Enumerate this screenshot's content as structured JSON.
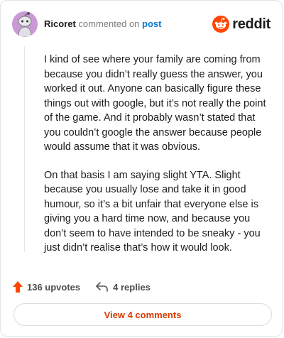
{
  "header": {
    "username": "Ricoret",
    "action_text": "commented on",
    "post_link": "post",
    "brand_name": "reddit"
  },
  "comment": {
    "paragraphs": [
      "I kind of see where your family are coming from because you didn’t really guess the answer, you worked it out. Anyone can basically figure these things out with google, but it’s not really the point of the game. And it probably wasn’t stated that you couldn’t google the answer because people would assume that it was obvious.",
      "On that basis I am saying slight YTA. Slight because you usually lose and take it in good humour, so it’s a bit unfair that everyone else is giving you a hard time now, and because you don’t seem to have intended to be sneaky - you just didn’t realise that’s how it would look."
    ]
  },
  "stats": {
    "upvotes": "136 upvotes",
    "replies": "4 replies"
  },
  "view_button": "View 4 comments",
  "colors": {
    "accent": "#ff4500",
    "link": "#0079d3",
    "button_text": "#d93a00",
    "avatar_bg": "#c99ad6"
  },
  "icons": {
    "avatar": "snoo-avatar-icon",
    "brand": "reddit-logo-icon",
    "upvote": "upvote-arrow-icon",
    "reply": "reply-arrow-icon"
  }
}
